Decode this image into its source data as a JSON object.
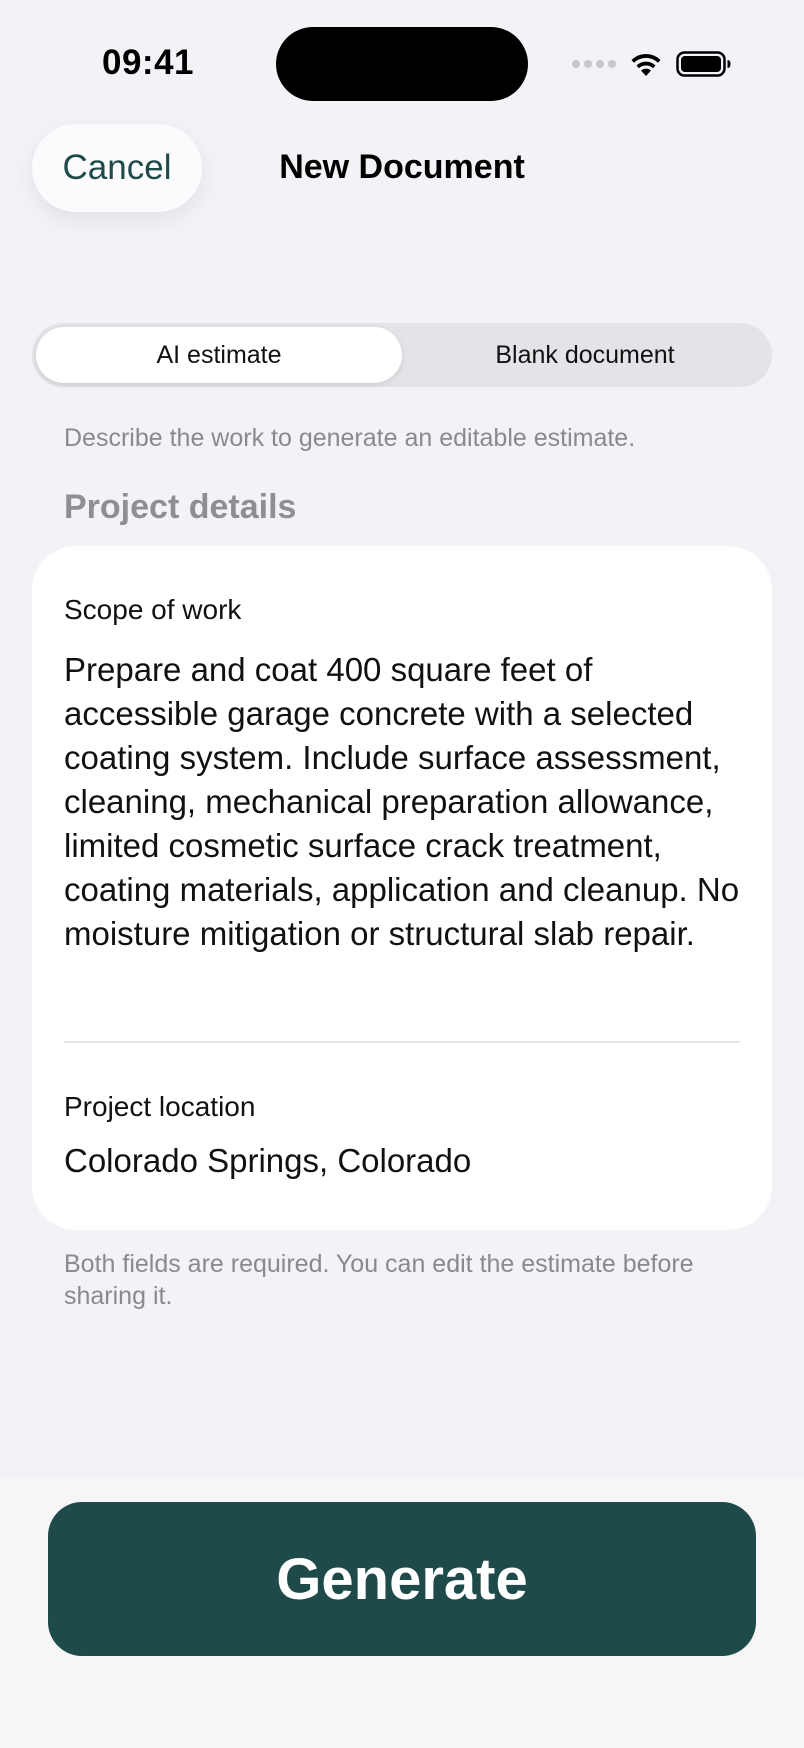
{
  "status_bar": {
    "time": "09:41",
    "icons": [
      "signal-dots-icon",
      "wifi-icon",
      "battery-icon"
    ]
  },
  "nav": {
    "cancel_label": "Cancel",
    "title": "New Document"
  },
  "segmented_control": {
    "options": [
      {
        "label": "AI estimate",
        "selected": true
      },
      {
        "label": "Blank document",
        "selected": false
      }
    ]
  },
  "helper_text": "Describe the work to generate an editable estimate.",
  "section_title": "Project details",
  "form": {
    "scope": {
      "label": "Scope of work",
      "value": "Prepare and coat 400 square feet of accessible garage concrete with a selected coating system. Include surface assessment, cleaning, mechanical preparation allowance, limited cosmetic surface crack treatment, coating materials, application and cleanup. No moisture mitigation or structural slab repair."
    },
    "location": {
      "label": "Project location",
      "value": "Colorado Springs, Colorado"
    }
  },
  "footnote": "Both fields are required. You can edit the estimate before sharing it.",
  "generate_label": "Generate",
  "colors": {
    "accent": "#1f4a4a",
    "background": "#f2f2f7",
    "card": "#ffffff",
    "secondary_text": "#8a8a8e"
  }
}
